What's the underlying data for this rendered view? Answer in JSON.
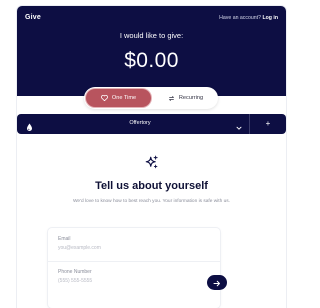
{
  "header": {
    "brand": "Give",
    "account_prompt": "Have an account?",
    "login_label": "Log in"
  },
  "donation": {
    "prompt": "I would like to give:",
    "amount": "$0.00"
  },
  "frequency": {
    "options": [
      {
        "label": "One Time",
        "icon": "heart-icon",
        "selected": true
      },
      {
        "label": "Recurring",
        "icon": "repeat-icon",
        "selected": false
      }
    ]
  },
  "fund": {
    "icon": "drop-icon",
    "selected": "Offertory",
    "add_label": "+"
  },
  "about": {
    "icon": "sparkle-icon",
    "title": "Tell us about yourself",
    "subtitle": "We'd love to know how to best reach you. Your information is safe with us."
  },
  "form": {
    "email_label": "Email",
    "email_placeholder": "you@example.com",
    "email_value": "",
    "phone_label": "Phone Number",
    "phone_placeholder": "(555) 555-5555",
    "phone_value": "",
    "next_icon": "arrow-right-icon"
  },
  "colors": {
    "navy": "#0d0e43",
    "accent": "#b8545e",
    "muted": "#8a8d9a"
  }
}
